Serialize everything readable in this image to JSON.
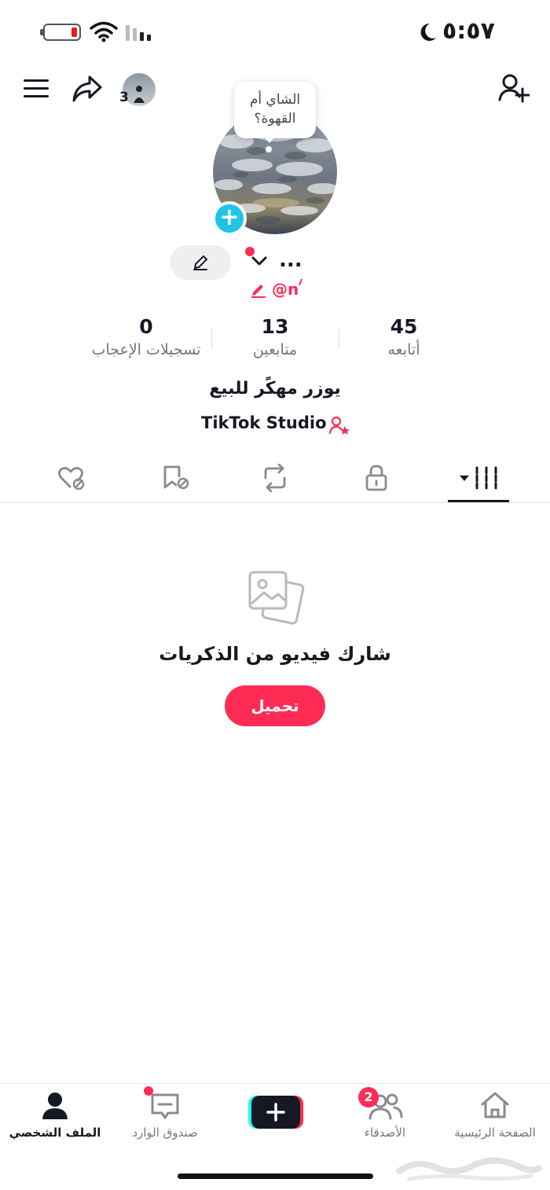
{
  "status_bar": {
    "time": "٥:٥٧"
  },
  "header": {
    "story_count": "3"
  },
  "profile": {
    "bubble_text_line1": "الشاي أم",
    "bubble_text_line2": "القهوة؟",
    "username": "...",
    "handle": "@n",
    "bio": "يوزر مهكًر للبيع",
    "studio_link": "TikTok Studio"
  },
  "stats": {
    "following": {
      "value": "45",
      "label": "أتابعه"
    },
    "followers": {
      "value": "13",
      "label": "متابعين"
    },
    "likes": {
      "value": "0",
      "label": "تسجيلات الإعجاب"
    }
  },
  "tabs": [
    {
      "icon": "videos-grid-icon",
      "active": true
    },
    {
      "icon": "lock-icon"
    },
    {
      "icon": "repost-icon"
    },
    {
      "icon": "favorites-icon"
    },
    {
      "icon": "liked-icon"
    }
  ],
  "empty_state": {
    "title": "شارك فيديو من الذكريات",
    "button": "تحميل"
  },
  "bottom_nav": {
    "home": "الصفحة الرئيسية",
    "friends": "الأصدقاء",
    "friends_badge": "2",
    "inbox": "صندوق الوارد",
    "profile": "الملف الشخصي"
  },
  "colors": {
    "accent": "#fe2c55",
    "cyan": "#20c4e6",
    "text": "#161823"
  }
}
